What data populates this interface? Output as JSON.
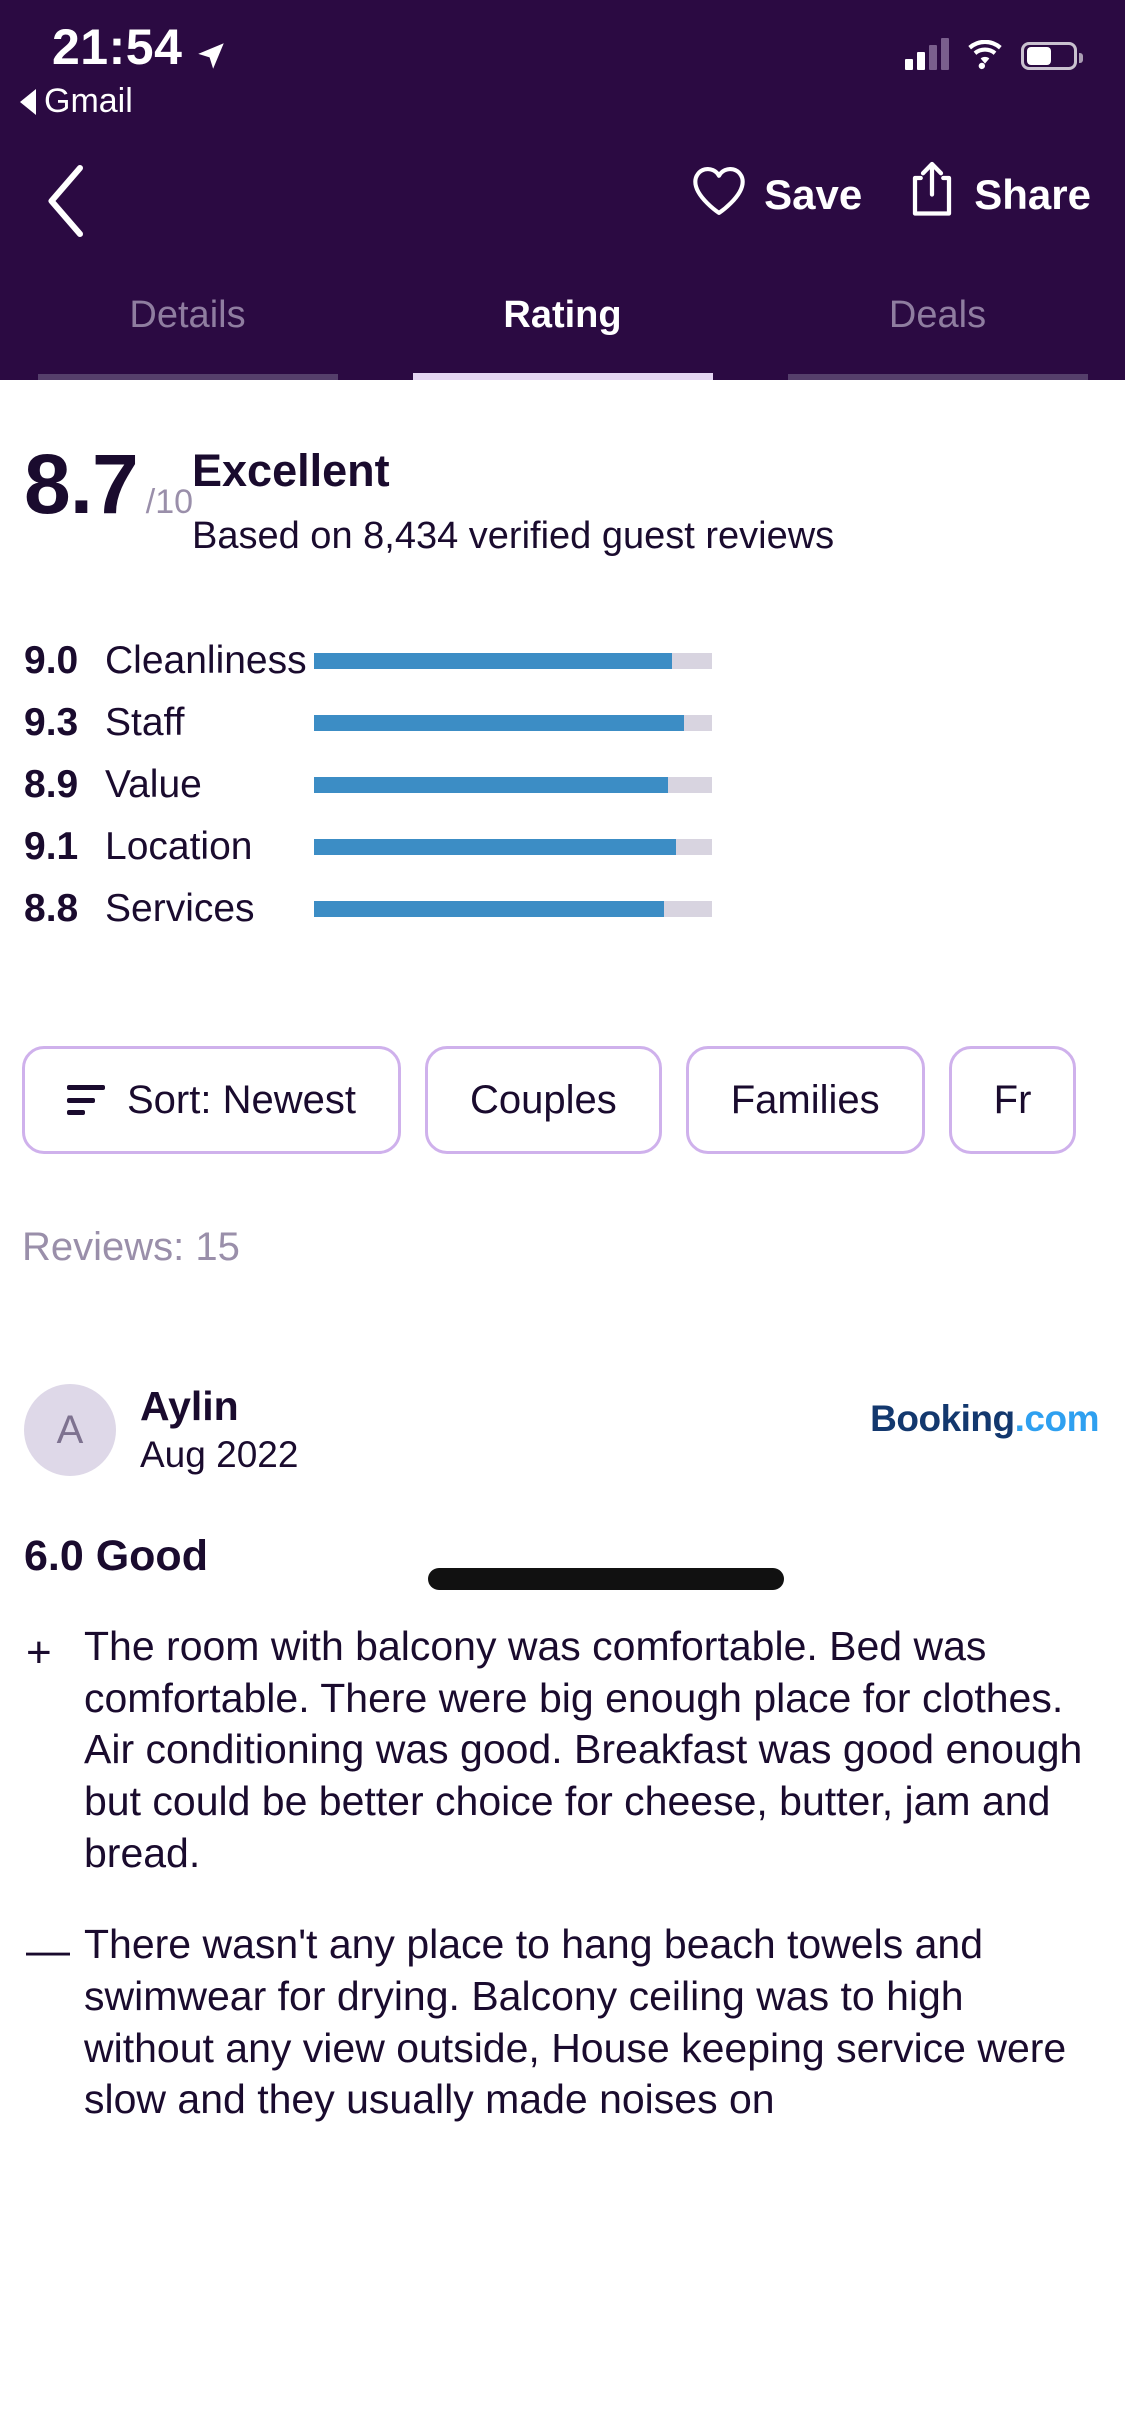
{
  "status_bar": {
    "time": "21:54",
    "location_icon": "location-arrow-icon",
    "return_app": "Gmail",
    "signal_icon": "cellular-signal-icon",
    "wifi_icon": "wifi-icon",
    "battery_icon": "battery-icon"
  },
  "nav": {
    "back_icon": "chevron-left-icon",
    "save_label": "Save",
    "save_icon": "heart-icon",
    "share_label": "Share",
    "share_icon": "share-upload-icon"
  },
  "tabs": [
    {
      "label": "Details",
      "active": false
    },
    {
      "label": "Rating",
      "active": true
    },
    {
      "label": "Deals",
      "active": false
    }
  ],
  "rating_summary": {
    "score": "8.7",
    "denominator": "/10",
    "title": "Excellent",
    "subtitle": "Based on 8,434 verified guest reviews"
  },
  "chart_data": {
    "type": "bar",
    "title": "Rating categories",
    "categories": [
      "Cleanliness",
      "Staff",
      "Value",
      "Location",
      "Services"
    ],
    "values": [
      9.0,
      9.3,
      8.9,
      9.1,
      8.8
    ],
    "value_labels": [
      "9.0",
      "9.3",
      "8.9",
      "9.1",
      "8.8"
    ],
    "xlabel": "",
    "ylabel": "",
    "ylim": [
      0,
      10
    ],
    "orientation": "horizontal",
    "grid": false,
    "legend": "none",
    "bar_color": "#3c8dc5",
    "track_color": "#d8d4e0"
  },
  "filters": {
    "chips": [
      {
        "label": "Sort: Newest",
        "icon": "sort-icon"
      },
      {
        "label": "Couples",
        "icon": ""
      },
      {
        "label": "Families",
        "icon": ""
      },
      {
        "label": "Fr",
        "icon": ""
      }
    ],
    "border_color": "#cfb1ec"
  },
  "reviews_header": {
    "count_label": "Reviews: 15"
  },
  "review": {
    "avatar_initial": "A",
    "name": "Aylin",
    "date": "Aug 2022",
    "source_brand_part1": "Booking",
    "source_brand_part2": ".com",
    "rating_line": "6.0 Good",
    "positive_sign": "+",
    "positive_text": "The room with balcony was comfortable. Bed was comfortable. There were big enough place for clothes. Air conditioning was good. Breakfast was good enough but could be better choice for cheese, butter, jam and bread.",
    "negative_sign": "—",
    "negative_text": "There wasn't any place to hang beach towels and swimwear for drying. Balcony ceiling was to high without any view outside, House keeping service were slow and they usually made noises on"
  },
  "colors": {
    "header_bg": "#2b0a42",
    "accent_bar": "#3c8dc5",
    "chip_border": "#cfb1ec",
    "text_dark": "#1a0b2e",
    "muted": "#9a8faa"
  }
}
